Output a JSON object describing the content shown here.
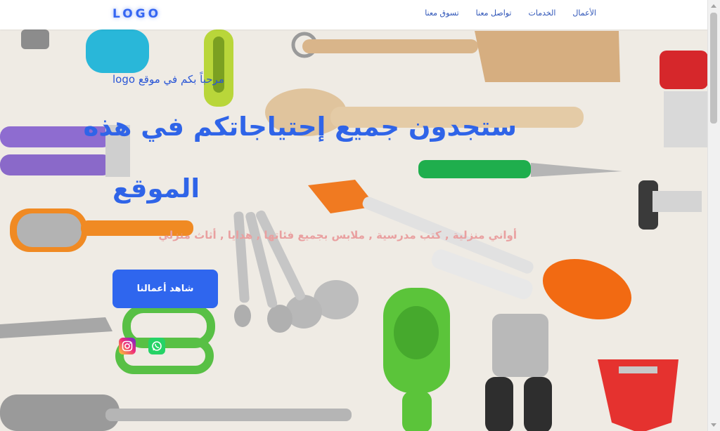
{
  "header": {
    "logo": "LOGO",
    "nav": [
      {
        "label": "الأعمال"
      },
      {
        "label": "الخدمات"
      },
      {
        "label": "تواصل معنا"
      },
      {
        "label": "تسوق معنا"
      }
    ]
  },
  "hero": {
    "welcome": "logo مرحباً بكم في موقع",
    "headline_line1": "ستجدون جميع إحتياجاتكم في هذه",
    "headline_line2": "الموقع",
    "subtitle": "أواني منزلية , كتب مدرسية , ملابس بجميع فئاتها , هدايا , أثاث منزلي",
    "cta": "شاهد أعمالنا"
  },
  "social": {
    "icons": [
      "instagram-icon",
      "whatsapp-icon"
    ]
  },
  "colors": {
    "accent": "#2f66ee",
    "subtitle": "#e9a0a0",
    "nav_text": "#2f55b8"
  }
}
